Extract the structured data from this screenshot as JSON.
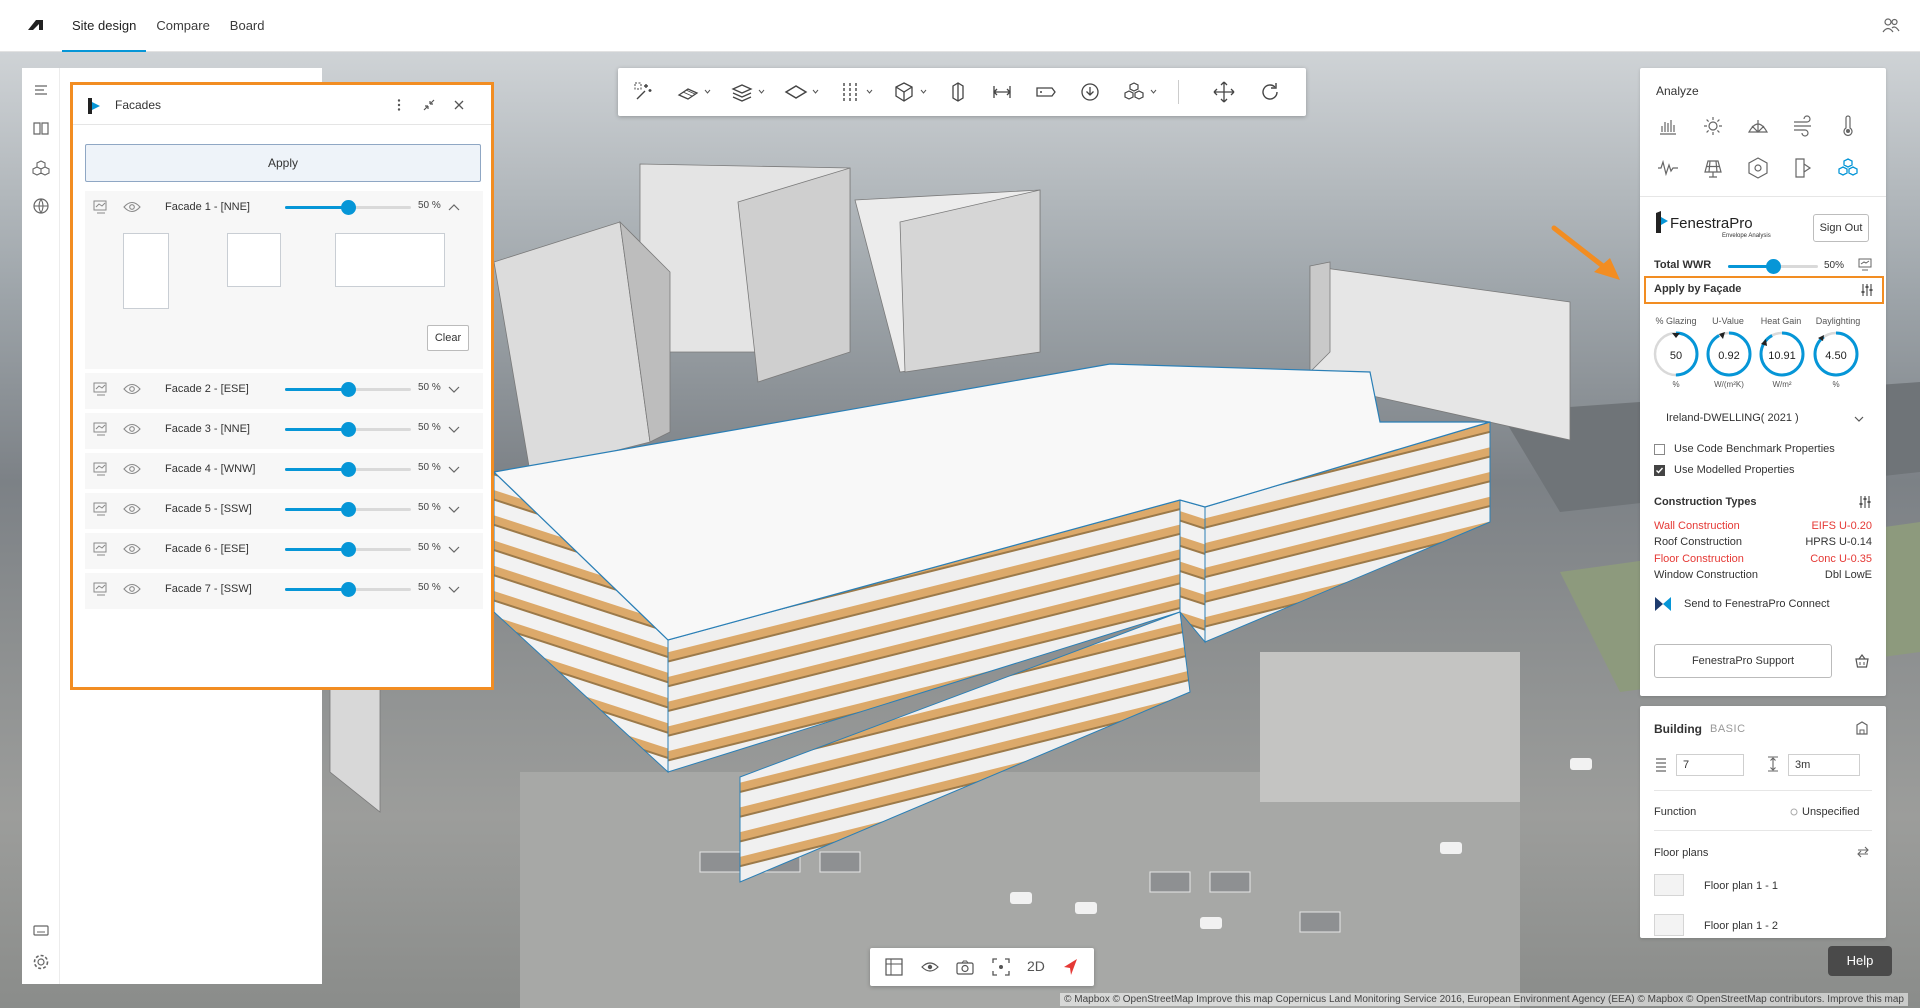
{
  "topbar": {
    "tabs": [
      {
        "label": "Site design",
        "active": true
      },
      {
        "label": "Compare",
        "active": false
      },
      {
        "label": "Board",
        "active": false
      }
    ]
  },
  "colors": {
    "accent": "#0696d7",
    "highlight": "#f28d22",
    "alert_red": "#e53935"
  },
  "facades_panel": {
    "title": "Facades",
    "apply_label": "Apply",
    "clear_label": "Clear",
    "rows": [
      {
        "name": "Facade 1 - [NNE]",
        "value": 50,
        "pct": "50 %",
        "expanded": true
      },
      {
        "name": "Facade 2 - [ESE]",
        "value": 50,
        "pct": "50 %",
        "expanded": false
      },
      {
        "name": "Facade 3 - [NNE]",
        "value": 50,
        "pct": "50 %",
        "expanded": false
      },
      {
        "name": "Facade 4 - [WNW]",
        "value": 50,
        "pct": "50 %",
        "expanded": false
      },
      {
        "name": "Facade 5 - [SSW]",
        "value": 50,
        "pct": "50 %",
        "expanded": false
      },
      {
        "name": "Facade 6 - [ESE]",
        "value": 50,
        "pct": "50 %",
        "expanded": false
      },
      {
        "name": "Facade 7 - [SSW]",
        "value": 50,
        "pct": "50 %",
        "expanded": false
      }
    ]
  },
  "bottom_toolbar": {
    "mode_label": "2D"
  },
  "analyze": {
    "title": "Analyze",
    "icons": [
      "bar-chart-icon",
      "sun-icon",
      "sky-dome-icon",
      "wind-icon",
      "thermometer-icon",
      "noise-wave-icon",
      "solar-panel-icon",
      "hexagon-icon",
      "daylight-icon",
      "fenestra-cubes-icon"
    ],
    "fenestra": {
      "brand": "FenestraPro",
      "subtitle": "Envelope Analysis",
      "sign_out": "Sign Out",
      "total_wwr_label": "Total WWR",
      "total_wwr_value": 50,
      "total_wwr_pct": "50%",
      "apply_by_facade": "Apply by Façade",
      "metrics": [
        {
          "label": "% Glazing",
          "value": "50",
          "unit": "%",
          "fraction": 0.5
        },
        {
          "label": "U-Value",
          "value": "0.92",
          "unit": "W/(m²K)",
          "fraction": 0.92
        },
        {
          "label": "Heat Gain",
          "value": "10.91",
          "unit": "W/m²",
          "fraction": 0.92
        },
        {
          "label": "Daylighting",
          "value": "4.50",
          "unit": "%",
          "fraction": 0.9
        }
      ],
      "benchmark": "Ireland-DWELLING( 2021 )",
      "use_code_benchmark": "Use Code Benchmark Properties",
      "use_code_benchmark_checked": false,
      "use_modelled": "Use Modelled Properties",
      "use_modelled_checked": true,
      "construction_types_title": "Construction Types",
      "construction_types": [
        {
          "label": "Wall Construction",
          "value": "EIFS U-0.20",
          "alert": true
        },
        {
          "label": "Roof Construction",
          "value": "HPRS U-0.14",
          "alert": false
        },
        {
          "label": "Floor Construction",
          "value": "Conc U-0.35",
          "alert": true
        },
        {
          "label": "Window Construction",
          "value": "Dbl LowE",
          "alert": false
        }
      ],
      "send_connect": "Send to FenestraPro Connect",
      "support": "FenestraPro Support"
    }
  },
  "building": {
    "title": "Building",
    "tag": "BASIC",
    "floors": "7",
    "floor_height": "3m",
    "function_label": "Function",
    "function_value": "Unspecified",
    "floor_plans_label": "Floor plans",
    "floor_plans": [
      "Floor plan 1 - 1",
      "Floor plan 1 - 2"
    ]
  },
  "help_label": "Help",
  "attribution": "© Mapbox © OpenStreetMap Improve this map Copernicus Land Monitoring Service 2016, European Environment Agency (EEA) © Mapbox © OpenStreetMap contributors. Improve this map"
}
